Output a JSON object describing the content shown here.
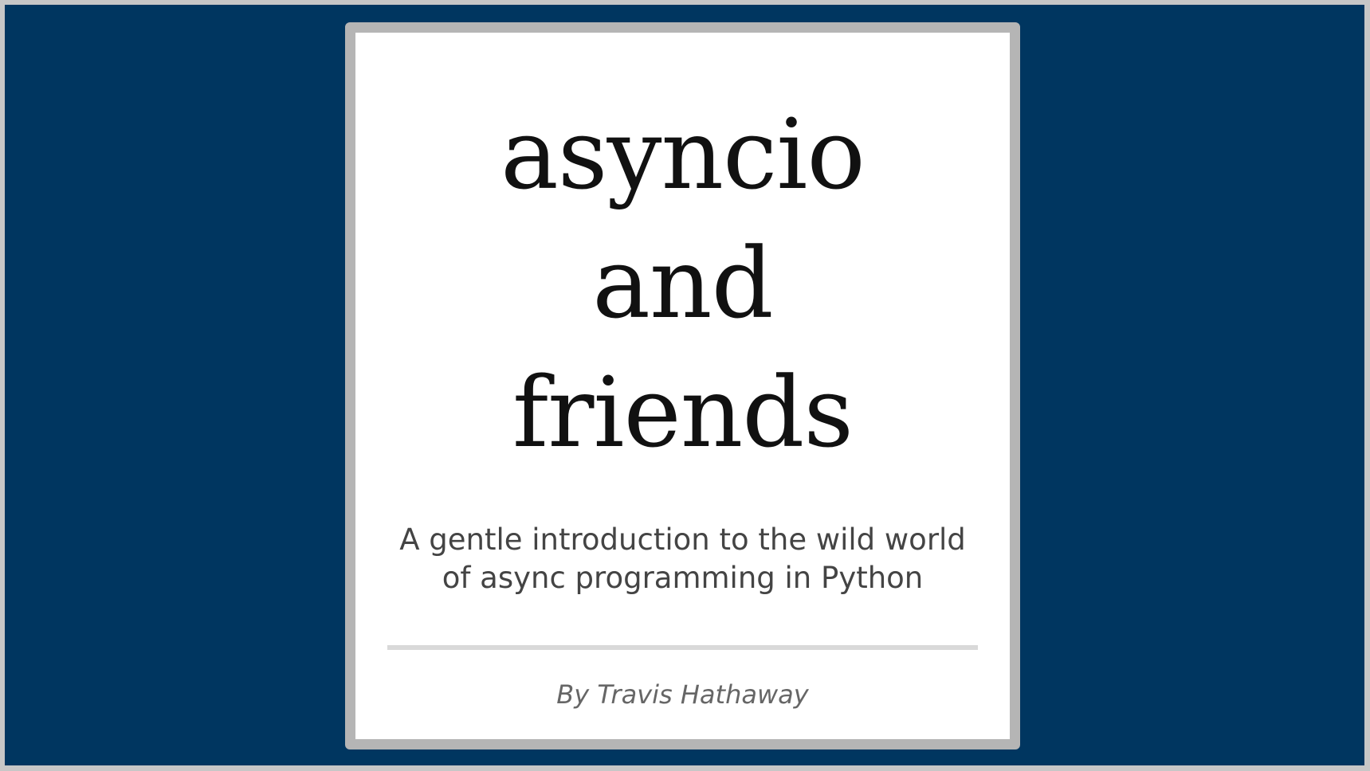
{
  "cover": {
    "title_lines": [
      "asyncio",
      "and",
      "friends"
    ],
    "subtitle_lines": [
      "A gentle introduction to the wild world",
      "of async programming in Python"
    ],
    "author": "By Travis Hathaway"
  },
  "colors": {
    "background": "#003660",
    "card_border": "#b5b5b5",
    "card": "#ffffff",
    "title_text": "#111111",
    "subtitle_text": "#444444",
    "author_text": "#666666",
    "divider": "#d9d9d9"
  }
}
